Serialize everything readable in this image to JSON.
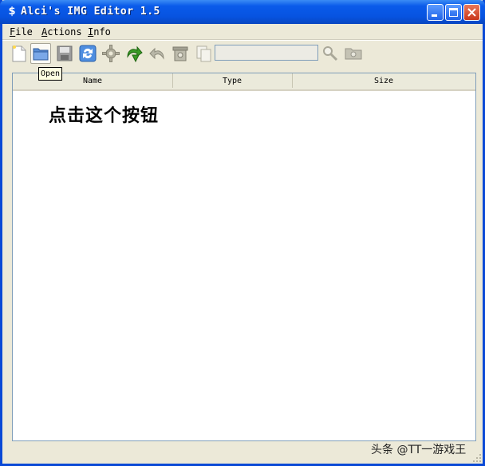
{
  "window": {
    "title": "Alci's IMG Editor 1.5",
    "icon": "app-dollar-icon"
  },
  "menu": {
    "items": [
      {
        "accel": "F",
        "rest": "ile"
      },
      {
        "accel": "A",
        "rest": "ctions"
      },
      {
        "accel": "I",
        "rest": "nfo"
      }
    ]
  },
  "toolbar": {
    "tools": [
      "new-file-icon",
      "open-folder-icon",
      "save-icon",
      "refresh-icon",
      "settings-gear-icon",
      "import-arrow-icon",
      "export-arrow-icon",
      "delete-bin-icon",
      "copy-icon"
    ],
    "search_value": "",
    "tooltip": "Open"
  },
  "list": {
    "columns": [
      "Name",
      "Type",
      "Size"
    ]
  },
  "overlay": {
    "caption": "点击这个按钮",
    "watermark": "头条 @TT一游戏王"
  },
  "colors": {
    "titlebar": "#0a5bea",
    "chrome": "#ece9d8",
    "accent_green": "#3a9a26"
  }
}
